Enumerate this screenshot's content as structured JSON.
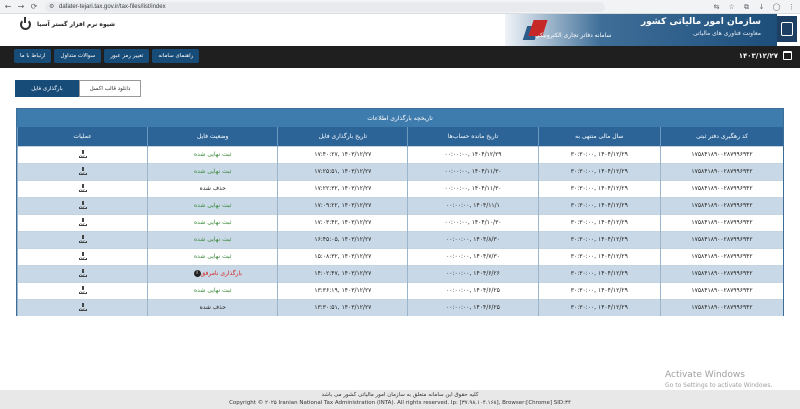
{
  "browser": {
    "url": "dafater-tejari.tax.gov.ir/tax-files/list/index"
  },
  "header": {
    "user_name": "شیوه نرم افزار گستر آسیا",
    "org_title": "سازمان امور مالیاتی کشور",
    "org_subtitle": "معاونت فناوری های مالیاتی",
    "system_title": "سامانه دفاتر تجاری الکترونیکی"
  },
  "nav": {
    "items": [
      "ارتباط با ما",
      "سوالات متداول",
      "تغییر رمز عبور",
      "راهنمای سامانه"
    ],
    "date": "۱۴۰۳/۱۲/۲۷"
  },
  "actions": {
    "upload_label": "بارگذاری فایل",
    "excel_label": "دانلود قالب اکسل"
  },
  "table": {
    "title": "تاریخچه بارگذاری اطلاعات",
    "columns": [
      "کد رهگیری دفتر ثبتی",
      "سال مالی منتهی به",
      "تاریخ مانده حساب‌ها",
      "تاریخ بارگذاری فایل",
      "وضعیت فایل",
      "عملیات"
    ],
    "rows": [
      {
        "code": "۱۷۵۸۴۱۸۹۰۰۲۸۷۹۹۶۹۴۲",
        "fiscal": "۱۴۰۴/۱۲/۲۹ ,۳۰:۳۰:۰۰",
        "balance": "۱۴۰۴/۱۲/۲۹ ,۰۰:۰۰:۰۰",
        "upload": "۱۴۰۳/۱۲/۲۷ ,۱۷:۴۰:۲۷",
        "status": "ثبت نهایی شده",
        "kind": "ok"
      },
      {
        "code": "۱۷۵۸۴۱۸۹۰۰۲۸۷۹۹۶۹۴۲",
        "fiscal": "۱۴۰۴/۱۲/۲۹ ,۳۰:۳۰:۰۰",
        "balance": "۱۴۰۴/۱۱/۳۰ ,۰۰:۰۰:۰۰",
        "upload": "۱۴۰۳/۱۲/۲۷ ,۱۷:۲۵:۵۱",
        "status": "ثبت نهایی شده",
        "kind": "ok"
      },
      {
        "code": "۱۷۵۸۴۱۸۹۰۰۲۸۷۹۹۶۹۴۲",
        "fiscal": "۱۴۰۴/۱۲/۲۹ ,۳۰:۳۰:۰۰",
        "balance": "۱۴۰۴/۱۱/۳۰ ,۰۰:۰۰:۰۰",
        "upload": "۱۴۰۳/۱۲/۲۷ ,۱۷:۲۲:۳۲",
        "status": "حذف شده",
        "kind": "del"
      },
      {
        "code": "۱۷۵۸۴۱۸۹۰۰۲۸۷۹۹۶۹۴۲",
        "fiscal": "۱۴۰۴/۱۲/۲۹ ,۳۰:۳۰:۰۰",
        "balance": "۱۴۰۴/۱۱/۱ ,۰۰:۰۰:۰۰",
        "upload": "۱۴۰۳/۱۲/۲۷ ,۱۷:۰۹:۲۲",
        "status": "ثبت نهایی شده",
        "kind": "ok"
      },
      {
        "code": "۱۷۵۸۴۱۸۹۰۰۲۸۷۹۹۶۹۴۲",
        "fiscal": "۱۴۰۴/۱۲/۲۹ ,۳۰:۳۰:۰۰",
        "balance": "۱۴۰۴/۱۰/۳۰ ,۰۰:۰۰:۰۰",
        "upload": "۱۴۰۳/۱۲/۲۷ ,۱۷:۰۳:۴۲",
        "status": "ثبت نهایی شده",
        "kind": "ok"
      },
      {
        "code": "۱۷۵۸۴۱۸۹۰۰۲۸۷۹۹۶۹۴۲",
        "fiscal": "۱۴۰۴/۱۲/۲۹ ,۳۰:۳۰:۰۰",
        "balance": "۱۴۰۴/۸/۳۰ ,۰۰:۰۰:۰۰",
        "upload": "۱۴۰۳/۱۲/۲۷ ,۱۶:۴۵:۰۵",
        "status": "ثبت نهایی شده",
        "kind": "ok"
      },
      {
        "code": "۱۷۵۸۴۱۸۹۰۰۲۸۷۹۹۶۹۴۲",
        "fiscal": "۱۴۰۴/۱۲/۲۹ ,۳۰:۳۰:۰۰",
        "balance": "۱۴۰۴/۷/۳۰ ,۰۰:۰۰:۰۰",
        "upload": "۱۴۰۳/۱۲/۲۷ ,۱۵:۰۸:۳۲",
        "status": "ثبت نهایی شده",
        "kind": "ok"
      },
      {
        "code": "۱۷۵۸۴۱۸۹۰۰۲۸۷۹۹۶۹۴۲",
        "fiscal": "۱۴۰۴/۱۲/۲۹ ,۳۰:۳۰:۰۰",
        "balance": "۱۴۰۴/۶/۲۶ ,۰۰:۰۰:۰۰",
        "upload": "۱۴۰۳/۱۲/۲۷ ,۱۴:۰۲:۴۷",
        "status": "بارگذاری نامرفق",
        "kind": "rej"
      },
      {
        "code": "۱۷۵۸۴۱۸۹۰۰۲۸۷۹۹۶۹۴۲",
        "fiscal": "۱۴۰۴/۱۲/۲۹ ,۳۰:۳۰:۰۰",
        "balance": "۱۴۰۴/۶/۲۵ ,۰۰:۰۰:۰۰",
        "upload": "۱۴۰۳/۱۲/۲۷ ,۱۳:۳۶:۱۹",
        "status": "ثبت نهایی شده",
        "kind": "ok"
      },
      {
        "code": "۱۷۵۸۴۱۸۹۰۰۲۸۷۹۹۶۹۴۲",
        "fiscal": "۱۴۰۴/۱۲/۲۹ ,۳۰:۳۰:۰۰",
        "balance": "۱۴۰۴/۶/۲۵ ,۰۰:۰۰:۰۰",
        "upload": "۱۴۰۳/۱۲/۲۷ ,۱۳:۳۰:۵۱",
        "status": "حذف شده",
        "kind": "del"
      }
    ]
  },
  "watermark": {
    "title": "Activate Windows",
    "subtitle": "Go to Settings to activate Windows."
  },
  "footer": {
    "line1": "کلیه حقوق این سامانه متعلق به سازمان امور مالیاتی کشور می باشد",
    "line2": "Copyright © ۲۰۲۵ Iranian National Tax Administration (INTA). All rights reserved. Ip: [۳۷.۹۸.۱۰۴.۱۶۸], Browser:[Chrome] SID:۳۴"
  }
}
